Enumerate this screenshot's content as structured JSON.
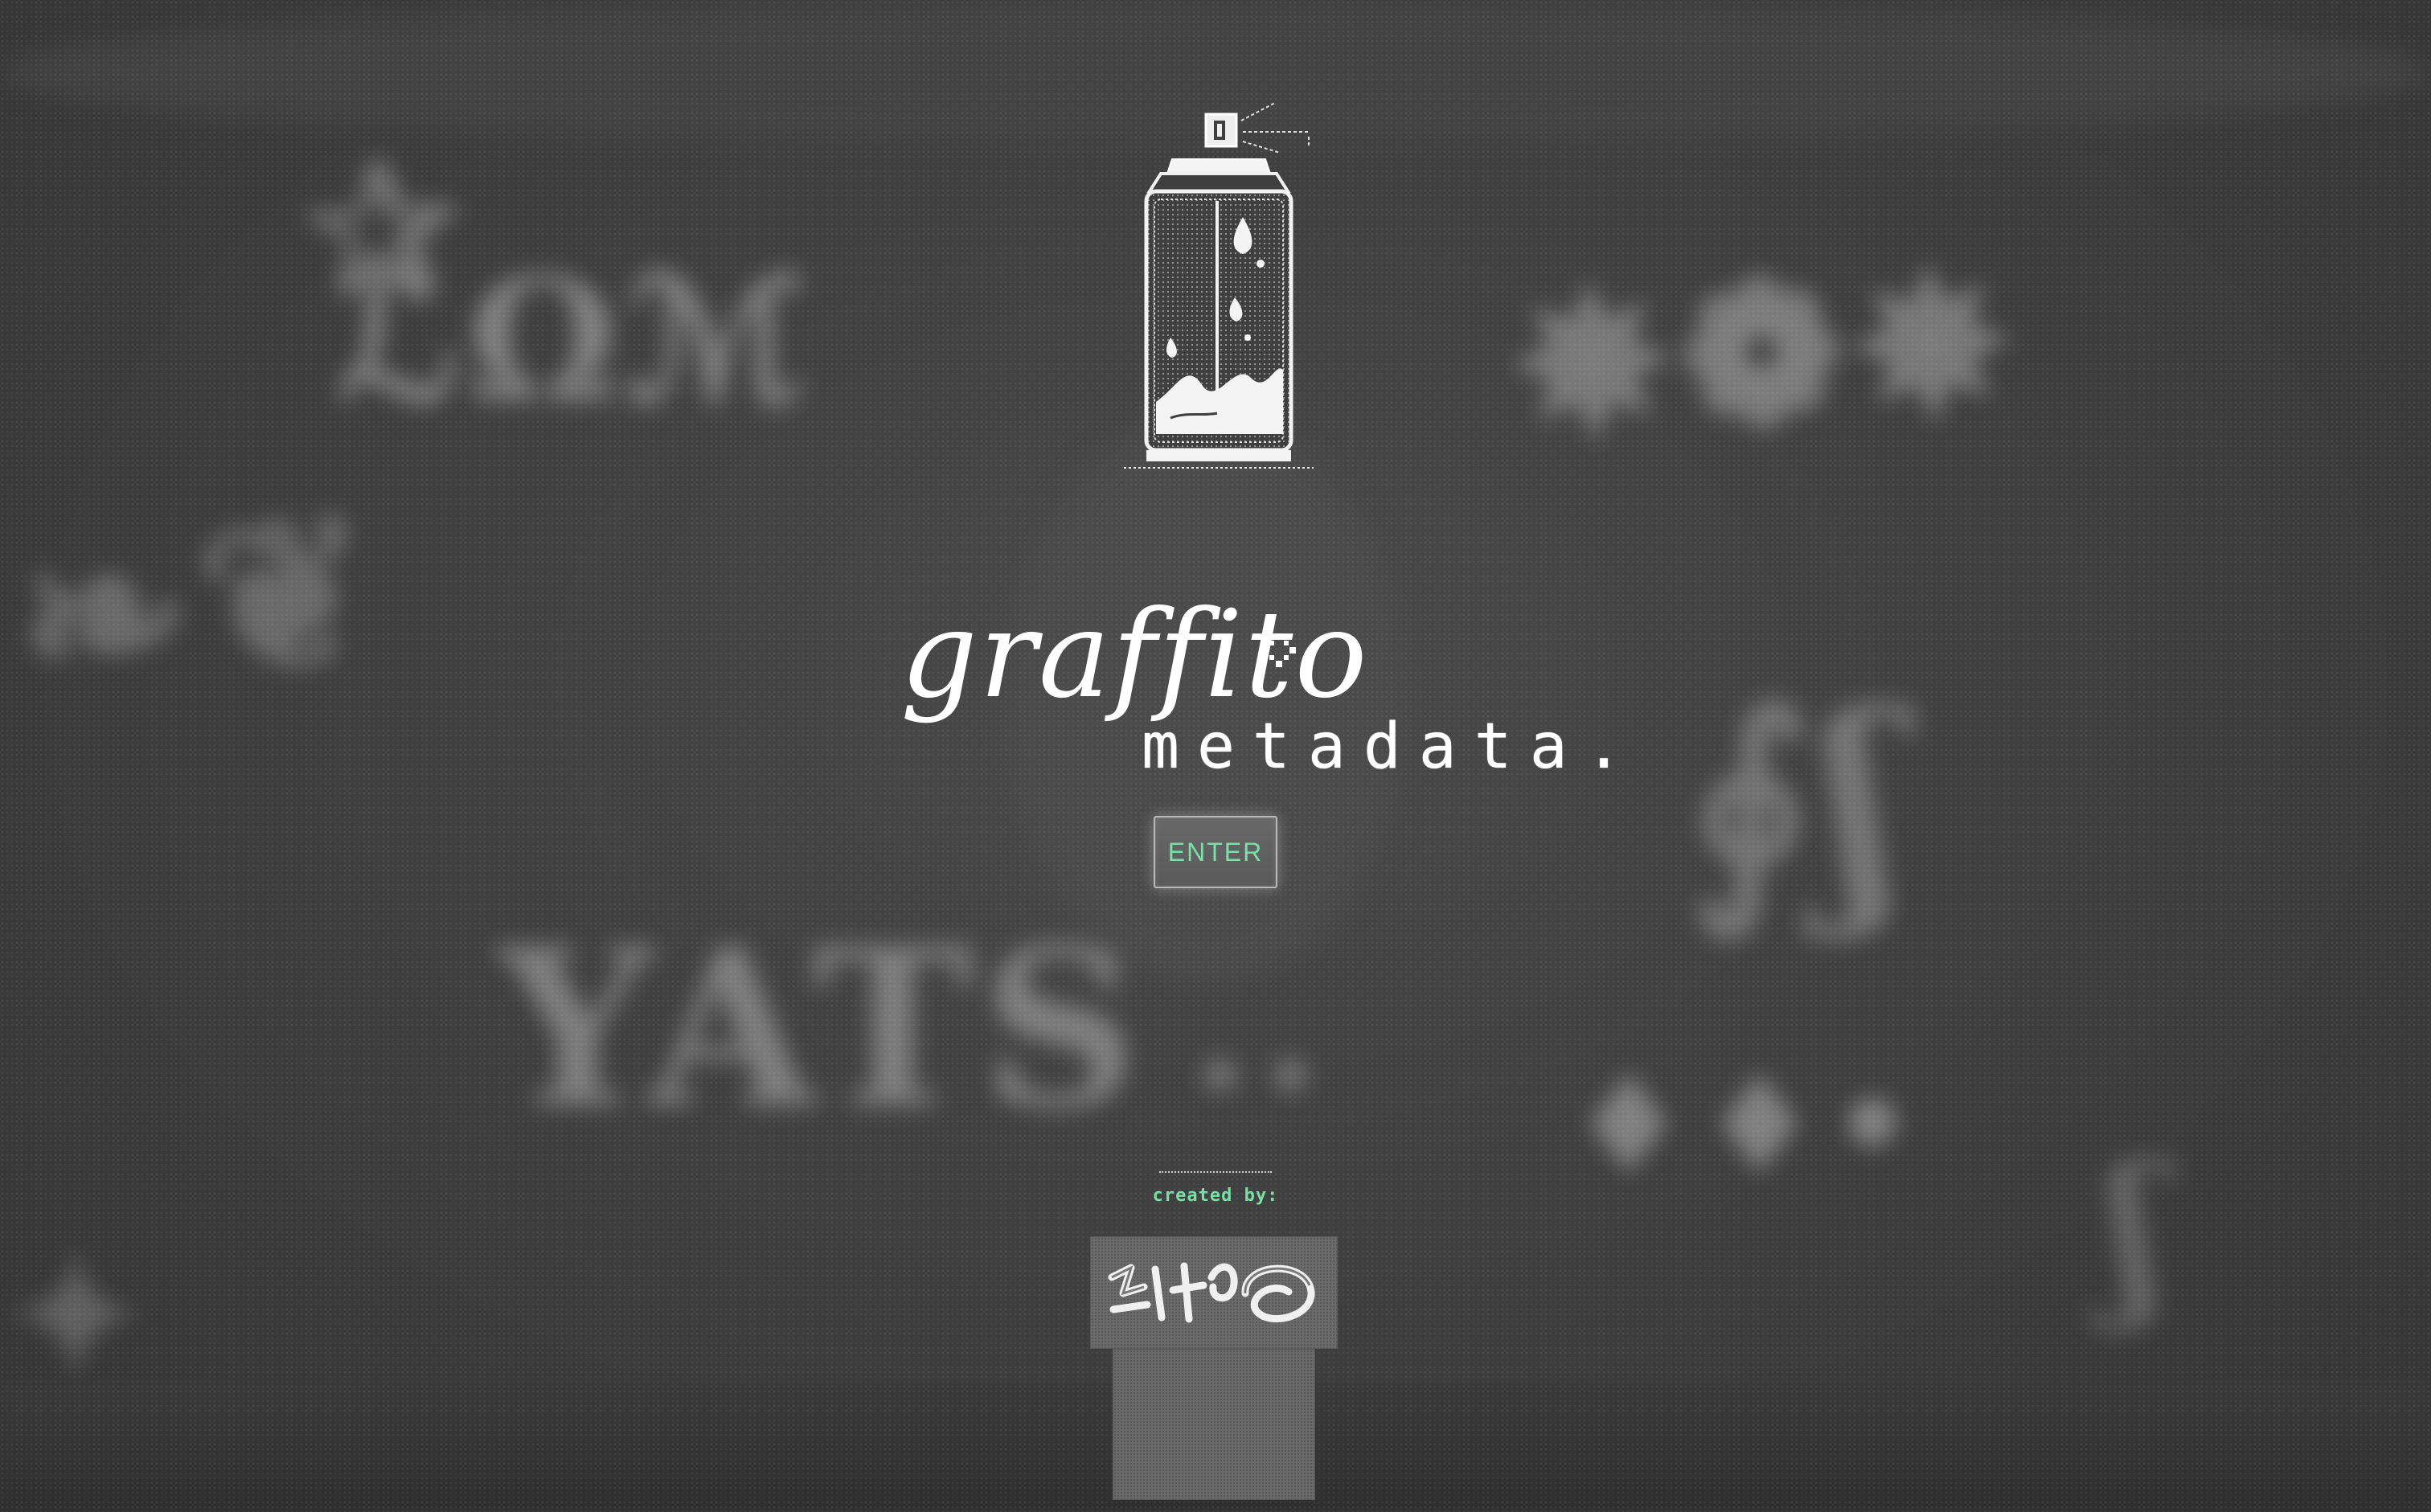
{
  "app": {
    "logo_script": "graffito",
    "logo_mono": "metadata."
  },
  "actions": {
    "enter_label": "ENTER"
  },
  "credits": {
    "label": "created by:"
  },
  "colors": {
    "accent": "#79e0a5",
    "background": "#404040",
    "foreground": "#ffffff"
  },
  "icons": {
    "spray_can": "spray-can-icon",
    "sparkle": "sparkle-icon"
  }
}
